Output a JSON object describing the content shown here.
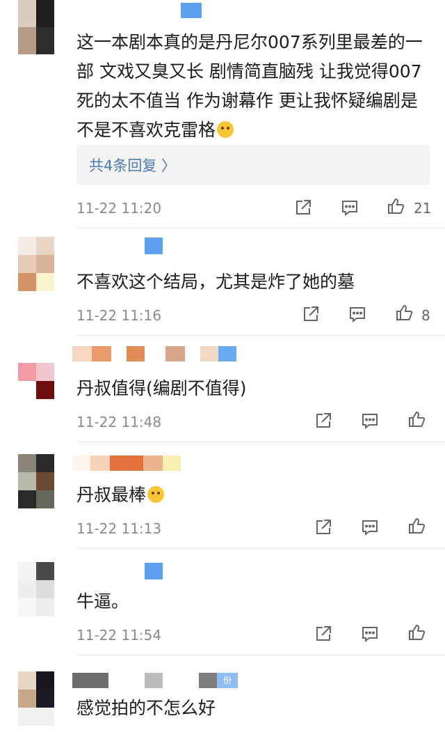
{
  "comments": [
    {
      "text": "这一本剧本真的是丹尼尔007系列里最差的一部  文戏又臭又长 剧情简直脑残 让我觉得007死的太不值当  作为谢幕作 更让我怀疑编剧是不是不喜欢克雷格",
      "time": "11-22 11:20",
      "likes": "21",
      "replies_label": "共4条回复 〉"
    },
    {
      "text": "不喜欢这个结局，尤其是炸了她的墓",
      "time": "11-22 11:16",
      "likes": "8"
    },
    {
      "text": "丹叔值得(编剧不值得)",
      "time": "11-22 11:48",
      "likes": ""
    },
    {
      "text": "丹叔最棒",
      "time": "11-22 11:13",
      "likes": ""
    },
    {
      "text": "牛逼。",
      "time": "11-22 11:54",
      "likes": ""
    },
    {
      "text": "感觉拍的不怎么好",
      "time": "",
      "likes": ""
    }
  ],
  "badge_text": "份",
  "colors": {
    "link": "#4d7ab4",
    "badge": "#5ea0ef",
    "meta": "#8a8a8a"
  },
  "icons": [
    "share-icon",
    "comment-icon",
    "like-icon"
  ]
}
